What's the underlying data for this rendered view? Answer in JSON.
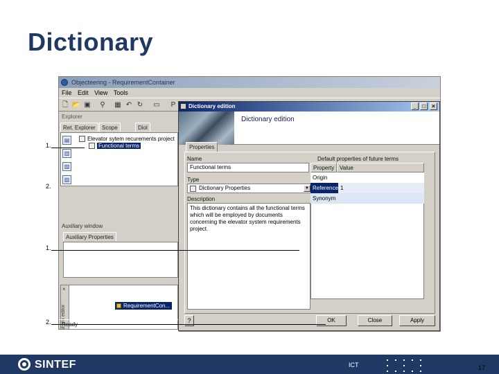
{
  "slide": {
    "title": "Dictionary",
    "page_number": "17",
    "footer_brand": "SINTEF",
    "footer_unit": "ICT"
  },
  "annotations": [
    "1.",
    "2.",
    "1.",
    "2."
  ],
  "app": {
    "window_title": "Objecteering - RequirementContainer",
    "menu": [
      "File",
      "Edit",
      "View",
      "Tools"
    ],
    "explorer_header": "Explorer",
    "explorer_tabs": [
      "Ret. Explorer",
      "Scope",
      "Diol"
    ],
    "tree": {
      "root": "Elevator sytem recurements project",
      "child": "Functional terms"
    },
    "auxiliary_header": "Auxiliary window",
    "auxiliary_tab": "Auxiliary Properties",
    "fast_link_label": "Fast link editor",
    "fast_link_item": "RequirementCon...",
    "status": "Ready"
  },
  "dialog": {
    "title": "Dictionary edition",
    "heading": "Dictionary edition",
    "tab": "Properties",
    "name_label": "Name",
    "name_value": "Functional terms",
    "type_label": "Type",
    "type_value": "Dictionary Properties",
    "description_label": "Description",
    "description_value": "This dictionary contains all the functional terms which will be employed by documents concerning the elevator system requirements project.",
    "default_props_label": "Default properties of future terms",
    "table_headers": [
      "Property",
      "Value"
    ],
    "table_rows": [
      {
        "property": "Origin",
        "value": ""
      },
      {
        "property": "Reference",
        "value": "1"
      },
      {
        "property": "Synonym",
        "value": ""
      }
    ],
    "buttons": {
      "help": "?",
      "ok": "OK",
      "close": "Close",
      "apply": "Apply"
    }
  }
}
